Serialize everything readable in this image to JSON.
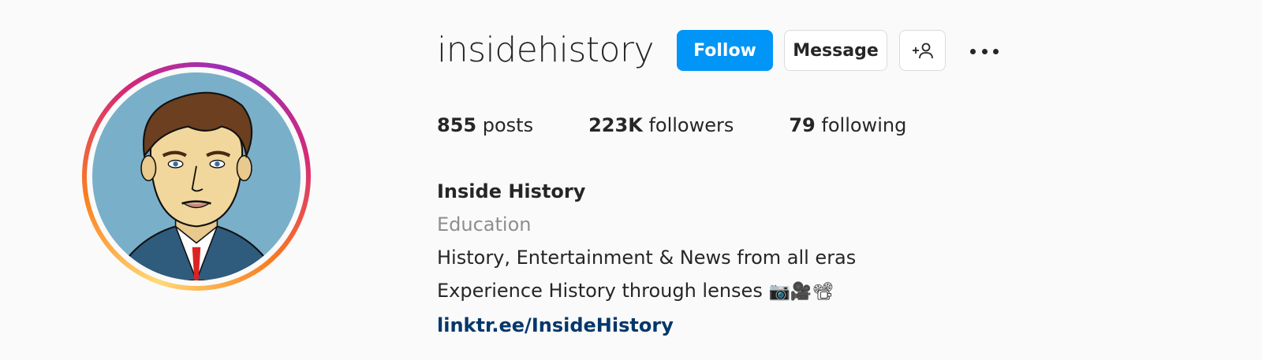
{
  "profile": {
    "username": "insidehistory",
    "full_name": "Inside History",
    "category": "Education",
    "bio_lines": [
      "History, Entertainment & News from all eras",
      "Experience History through lenses"
    ],
    "bio_emojis": "📷🎥📽",
    "link": "linktr.ee/InsideHistory"
  },
  "actions": {
    "follow_label": "Follow",
    "message_label": "Message"
  },
  "stats": {
    "posts_count": "855",
    "posts_label": "posts",
    "followers_count": "223K",
    "followers_label": "followers",
    "following_count": "79",
    "following_label": "following"
  },
  "icons": {
    "suggest": "add-person-icon",
    "more": "more-options-icon",
    "avatar": "profile-portrait"
  },
  "colors": {
    "follow_button": "#0095f6",
    "link": "#00376b",
    "category": "#8e8e8e"
  }
}
